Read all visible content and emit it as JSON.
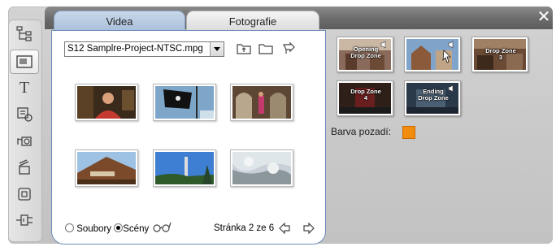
{
  "tabs": [
    {
      "label": "Videa",
      "active": true
    },
    {
      "label": "Fotografie",
      "active": false
    }
  ],
  "close_icon": "close-icon",
  "sidebar": {
    "tools": [
      {
        "icon": "menu-tree-icon",
        "active": false
      },
      {
        "icon": "thumbnail-icon",
        "active": true
      },
      {
        "icon": "title-t-icon",
        "active": false
      },
      {
        "icon": "sound-icon",
        "active": false
      },
      {
        "icon": "camera-music-icon",
        "active": false
      },
      {
        "icon": "clapper-icon",
        "active": false
      },
      {
        "icon": "frame-icon",
        "active": false
      },
      {
        "icon": "plug-icon",
        "active": false
      }
    ]
  },
  "file_select": {
    "value": "S12 Samplre-Project-NTSC.mpg"
  },
  "toolbar_icons": [
    "up-folder-icon",
    "open-folder-icon",
    "arrow-icon"
  ],
  "thumbnails": [
    {
      "subject": "man-portrait"
    },
    {
      "subject": "pirate-flag"
    },
    {
      "subject": "woman-arches"
    },
    {
      "subject": "wooden-house"
    },
    {
      "subject": "blue-sky-tower"
    },
    {
      "subject": "trees-water"
    }
  ],
  "footer": {
    "radio_files": "Soubory",
    "radio_scenes": "Scény",
    "selected": "Scény",
    "page_text": "Stránka 2 ze 6"
  },
  "drop_zones": [
    {
      "label_line1": "Opening",
      "label_line2": "Drop Zone",
      "has_sound": true
    },
    {
      "label_line1": "",
      "label_line2": "",
      "has_sound": true
    },
    {
      "label_line1": "Drop Zone",
      "label_line2": "3",
      "has_sound": false
    },
    {
      "label_line1": "Drop Zone",
      "label_line2": "4",
      "has_sound": false
    },
    {
      "label_line1": "Ending",
      "label_line2": "Drop Zone",
      "has_sound": true
    }
  ],
  "background": {
    "label": "Barva pozadí:",
    "color": "#f28c0f"
  }
}
